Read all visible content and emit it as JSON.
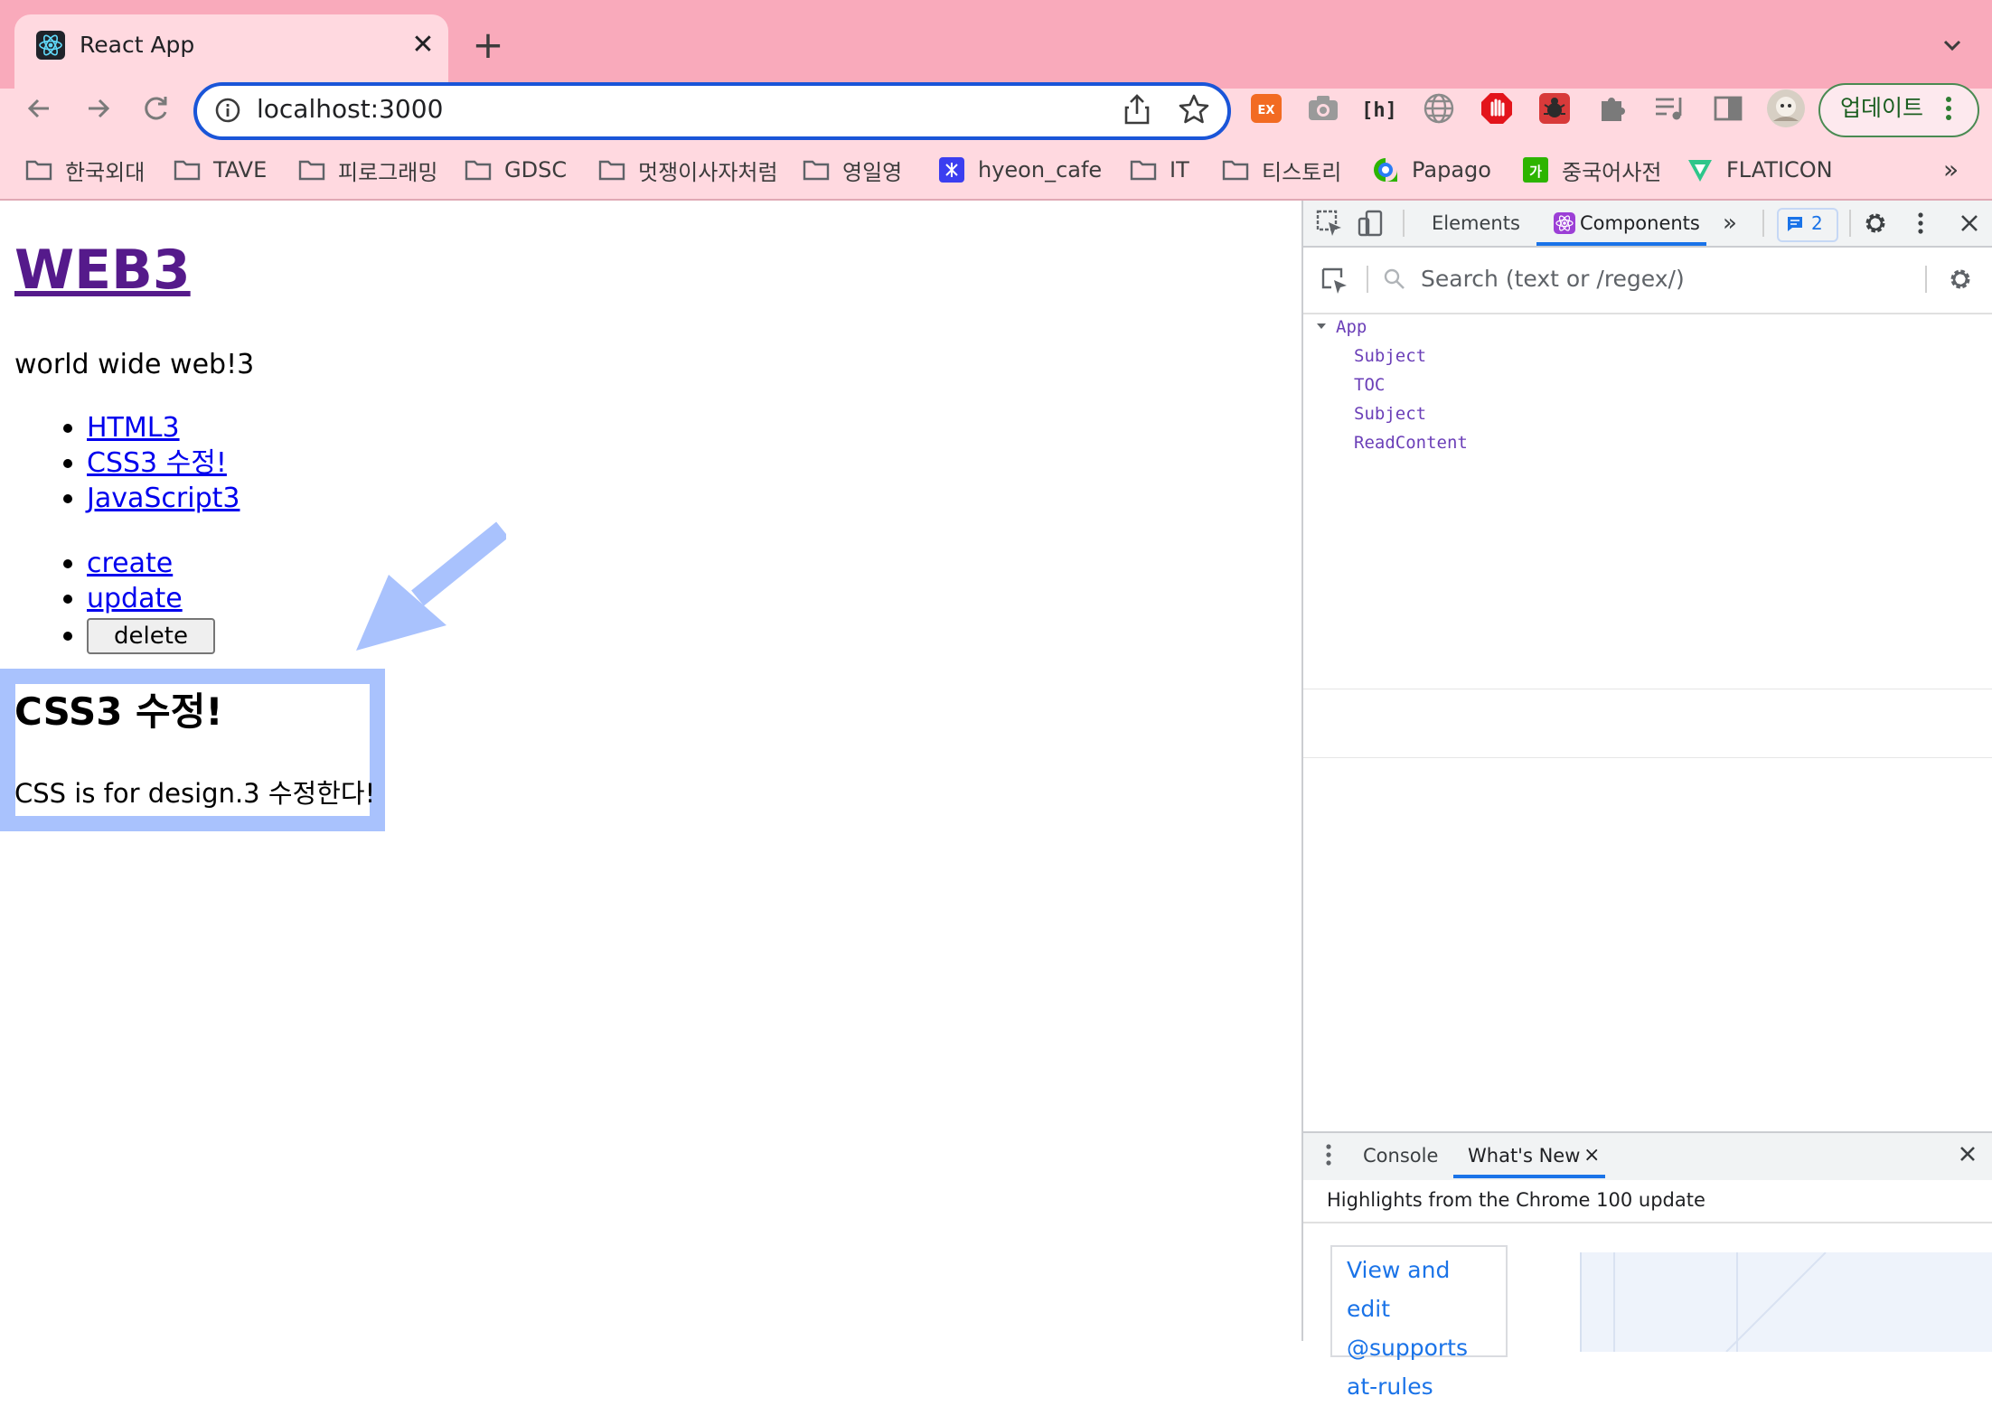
{
  "browser": {
    "tab": {
      "title": "React App",
      "close_glyph": "✕"
    },
    "new_tab_glyph": "+",
    "address": {
      "url": "localhost:3000"
    },
    "update_button": {
      "label": "업데이트"
    },
    "bookmarks": [
      {
        "label": "한국외대",
        "icon": "folder-icon"
      },
      {
        "label": "TAVE",
        "icon": "folder-icon"
      },
      {
        "label": "피로그래밍",
        "icon": "folder-icon"
      },
      {
        "label": "GDSC",
        "icon": "folder-icon"
      },
      {
        "label": "멋쟁이사자처럼",
        "icon": "folder-icon"
      },
      {
        "label": "영일영",
        "icon": "folder-icon"
      },
      {
        "label": "hyeon_cafe",
        "icon": "hyeon-cafe-icon"
      },
      {
        "label": "IT",
        "icon": "folder-icon"
      },
      {
        "label": "티스토리",
        "icon": "folder-icon"
      },
      {
        "label": "Papago",
        "icon": "papago-icon"
      },
      {
        "label": "중국어사전",
        "icon": "chinese-dictionary-icon"
      },
      {
        "label": "FLATICON",
        "icon": "flaticon-icon"
      }
    ],
    "bookmarks_more": "»"
  },
  "page": {
    "subject": {
      "title": "WEB3",
      "sub": "world wide web!3"
    },
    "toc": [
      "HTML3",
      "CSS3 수정!",
      "JavaScript3"
    ],
    "controls": {
      "create": "create",
      "update": "update",
      "delete": "delete"
    },
    "content": {
      "title": "CSS3 수정!",
      "desc": "CSS is for design.3 수정한다!"
    }
  },
  "devtools": {
    "tabs": [
      "Elements",
      "Components"
    ],
    "more_tabs": "»",
    "issues_count": "2",
    "search_placeholder": "Search (text or /regex/)",
    "tree": {
      "root": "App",
      "children": [
        "Subject",
        "TOC",
        "Subject",
        "ReadContent"
      ]
    },
    "drawer": {
      "tabs": [
        "Console",
        "What's New"
      ],
      "close_glyph": "×",
      "headline": "Highlights from the Chrome 100 update",
      "card_text": "View and edit @supports at-rules"
    }
  },
  "colors": {
    "tabstrip": "#f9aabb",
    "toolbar": "#ffd9e0",
    "omnibox_border": "#1a55d8",
    "visited_link": "#551a8b",
    "link": "#0000ee",
    "highlight_box": "#a9c2fd",
    "react_component": "#6b3fb8",
    "devtools_accent": "#1a73e8"
  }
}
